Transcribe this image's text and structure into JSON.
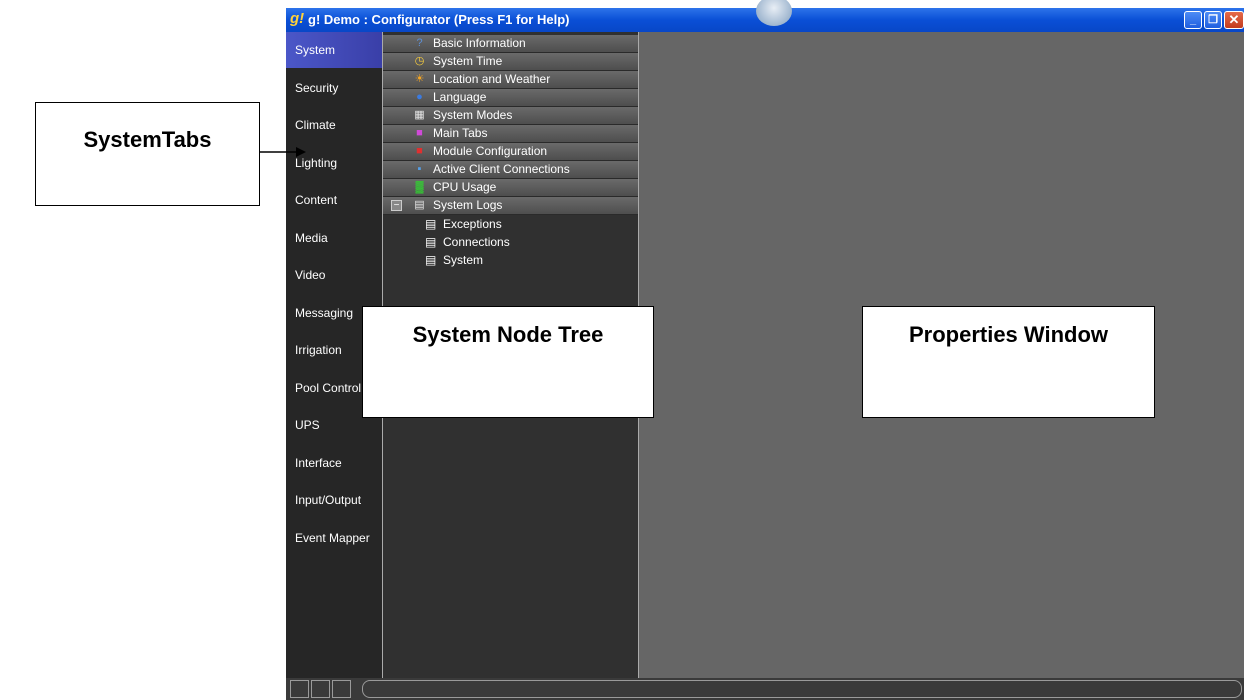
{
  "window": {
    "app_icon": "g!",
    "title": "g! Demo : Configurator   (Press F1 for Help)",
    "buttons": {
      "minimize": "_",
      "maximize": "❐",
      "close": "✕"
    }
  },
  "tabs": [
    {
      "label": "System",
      "active": true
    },
    {
      "label": "Security"
    },
    {
      "label": "Climate"
    },
    {
      "label": "Lighting"
    },
    {
      "label": "Content"
    },
    {
      "label": "Media"
    },
    {
      "label": "Video"
    },
    {
      "label": "Messaging"
    },
    {
      "label": "Irrigation"
    },
    {
      "label": "Pool Control"
    },
    {
      "label": "UPS"
    },
    {
      "label": "Interface"
    },
    {
      "label": "Input/Output"
    },
    {
      "label": "Event Mapper"
    }
  ],
  "tree": {
    "nodes": [
      {
        "label": "Basic Information",
        "icon": "info-icon",
        "glyph": "?",
        "color": "#5c8fd6"
      },
      {
        "label": "System Time",
        "icon": "clock-icon",
        "glyph": "◷",
        "color": "#ffd23a"
      },
      {
        "label": "Location and Weather",
        "icon": "weather-icon",
        "glyph": "☀",
        "color": "#f5a623"
      },
      {
        "label": "Language",
        "icon": "globe-icon",
        "glyph": "●",
        "color": "#3b7be0"
      },
      {
        "label": "System Modes",
        "icon": "modes-icon",
        "glyph": "▦",
        "color": "#e6e6e6"
      },
      {
        "label": "Main Tabs",
        "icon": "main-tabs-icon",
        "glyph": "■",
        "color": "#d04ad8"
      },
      {
        "label": "Module Configuration",
        "icon": "module-icon",
        "glyph": "■",
        "color": "#e03030"
      },
      {
        "label": "Active Client Connections",
        "icon": "connections-icon",
        "glyph": "▪",
        "color": "#56a0e8"
      },
      {
        "label": "CPU Usage",
        "icon": "cpu-icon",
        "glyph": "▓",
        "color": "#33cc33"
      },
      {
        "label": "System Logs",
        "icon": "logs-icon",
        "glyph": "▤",
        "color": "#e6e6e6",
        "expander": "−"
      }
    ],
    "children": [
      {
        "label": "Exceptions",
        "icon": "log-file-icon",
        "glyph": "▤"
      },
      {
        "label": "Connections",
        "icon": "log-file-icon",
        "glyph": "▤"
      },
      {
        "label": "System",
        "icon": "log-file-icon",
        "glyph": "▤"
      }
    ]
  },
  "callouts": {
    "tabs": "SystemTabs",
    "tree": "System Node Tree",
    "properties": "Properties Window"
  }
}
